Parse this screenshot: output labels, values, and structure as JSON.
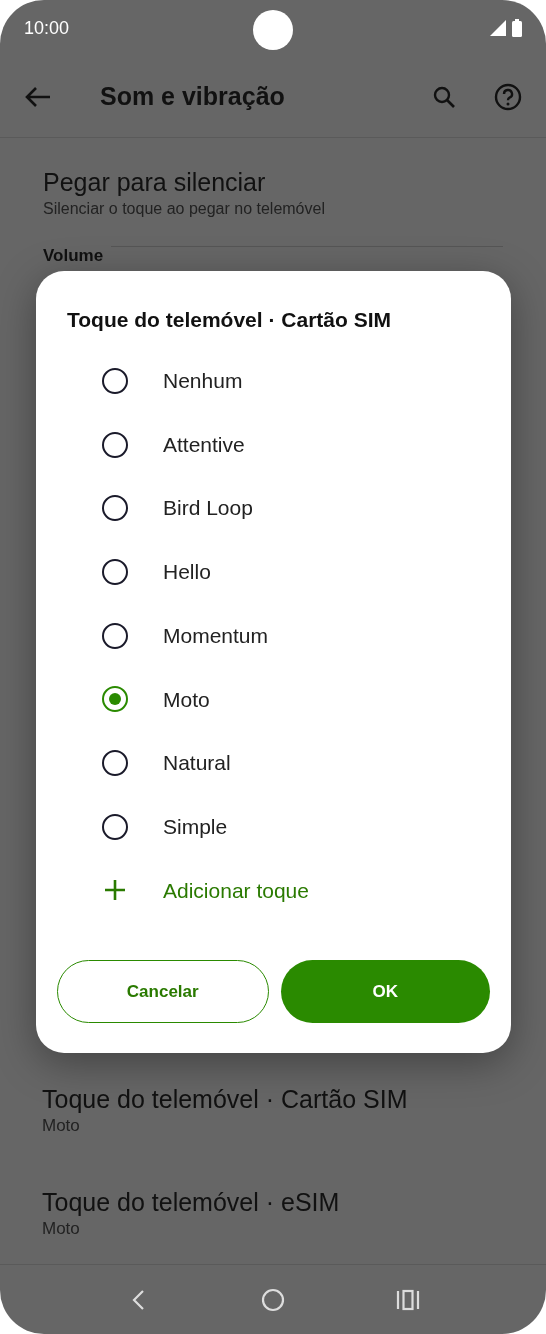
{
  "status_bar": {
    "time": "10:00"
  },
  "app_bar": {
    "title": "Som e vibração"
  },
  "top_settings": [
    {
      "title": "Pegar para silenciar",
      "subtitle": "Silenciar o toque ao pegar no telemóvel"
    }
  ],
  "section_header": "Volume",
  "bottom_settings": [
    {
      "title": "Toque do telemóvel · Cartão SIM",
      "subtitle": "Moto"
    },
    {
      "title": "Toque do telemóvel · eSIM",
      "subtitle": "Moto"
    }
  ],
  "dialog": {
    "title": "Toque do telemóvel · Cartão SIM",
    "options": [
      {
        "label": "Nenhum",
        "selected": false
      },
      {
        "label": "Attentive",
        "selected": false
      },
      {
        "label": "Bird Loop",
        "selected": false
      },
      {
        "label": "Hello",
        "selected": false
      },
      {
        "label": "Momentum",
        "selected": false
      },
      {
        "label": "Moto",
        "selected": true
      },
      {
        "label": "Natural",
        "selected": false
      },
      {
        "label": "Simple",
        "selected": false
      }
    ],
    "add_action": "Adicionar toque",
    "buttons": [
      {
        "label": "Cancelar",
        "kind": "outlined"
      },
      {
        "label": "OK",
        "kind": "filled"
      }
    ]
  }
}
